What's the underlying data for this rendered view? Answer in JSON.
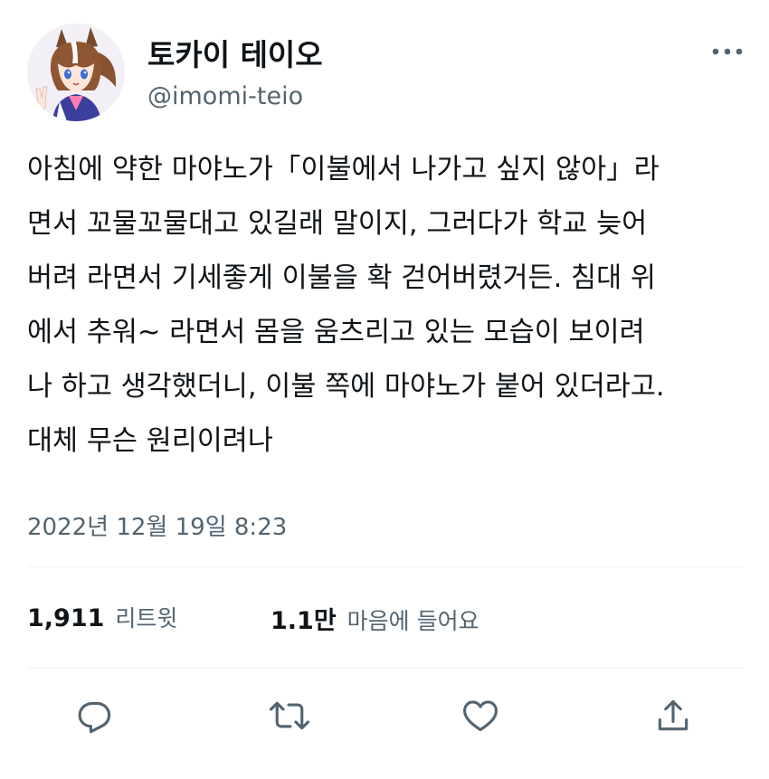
{
  "user": {
    "display_name": "토카이 테이오",
    "handle": "@imomi-teio"
  },
  "tweet": {
    "lines": [
      "아침에 약한 마야노가「이불에서 나가고 싶지 않아」라",
      "면서 꼬물꼬물대고 있길래 말이지, 그러다가 학교 늦어",
      "버려 라면서 기세좋게 이불을 확 걷어버렸거든. 침대 위",
      "에서 추워~ 라면서 몸을 움츠리고 있는 모습이 보이려",
      "나 하고 생각했더니, 이불 쪽에 마야노가 붙어 있더라고.",
      "대체 무슨 원리이려나"
    ],
    "timestamp": "2022년 12월 19일 8:23"
  },
  "stats": {
    "retweets_count": "1,911",
    "retweets_label": "리트윗",
    "likes_count": "1.1만",
    "likes_label": "마음에 들어요"
  },
  "icons": {
    "more": "more-horizontal-icon",
    "reply": "reply-icon",
    "retweet": "retweet-icon",
    "like": "heart-icon",
    "share": "share-icon"
  },
  "colors": {
    "text_primary": "#0f1419",
    "text_secondary": "#536471",
    "divider": "#eff3f4",
    "icon": "#536471"
  }
}
